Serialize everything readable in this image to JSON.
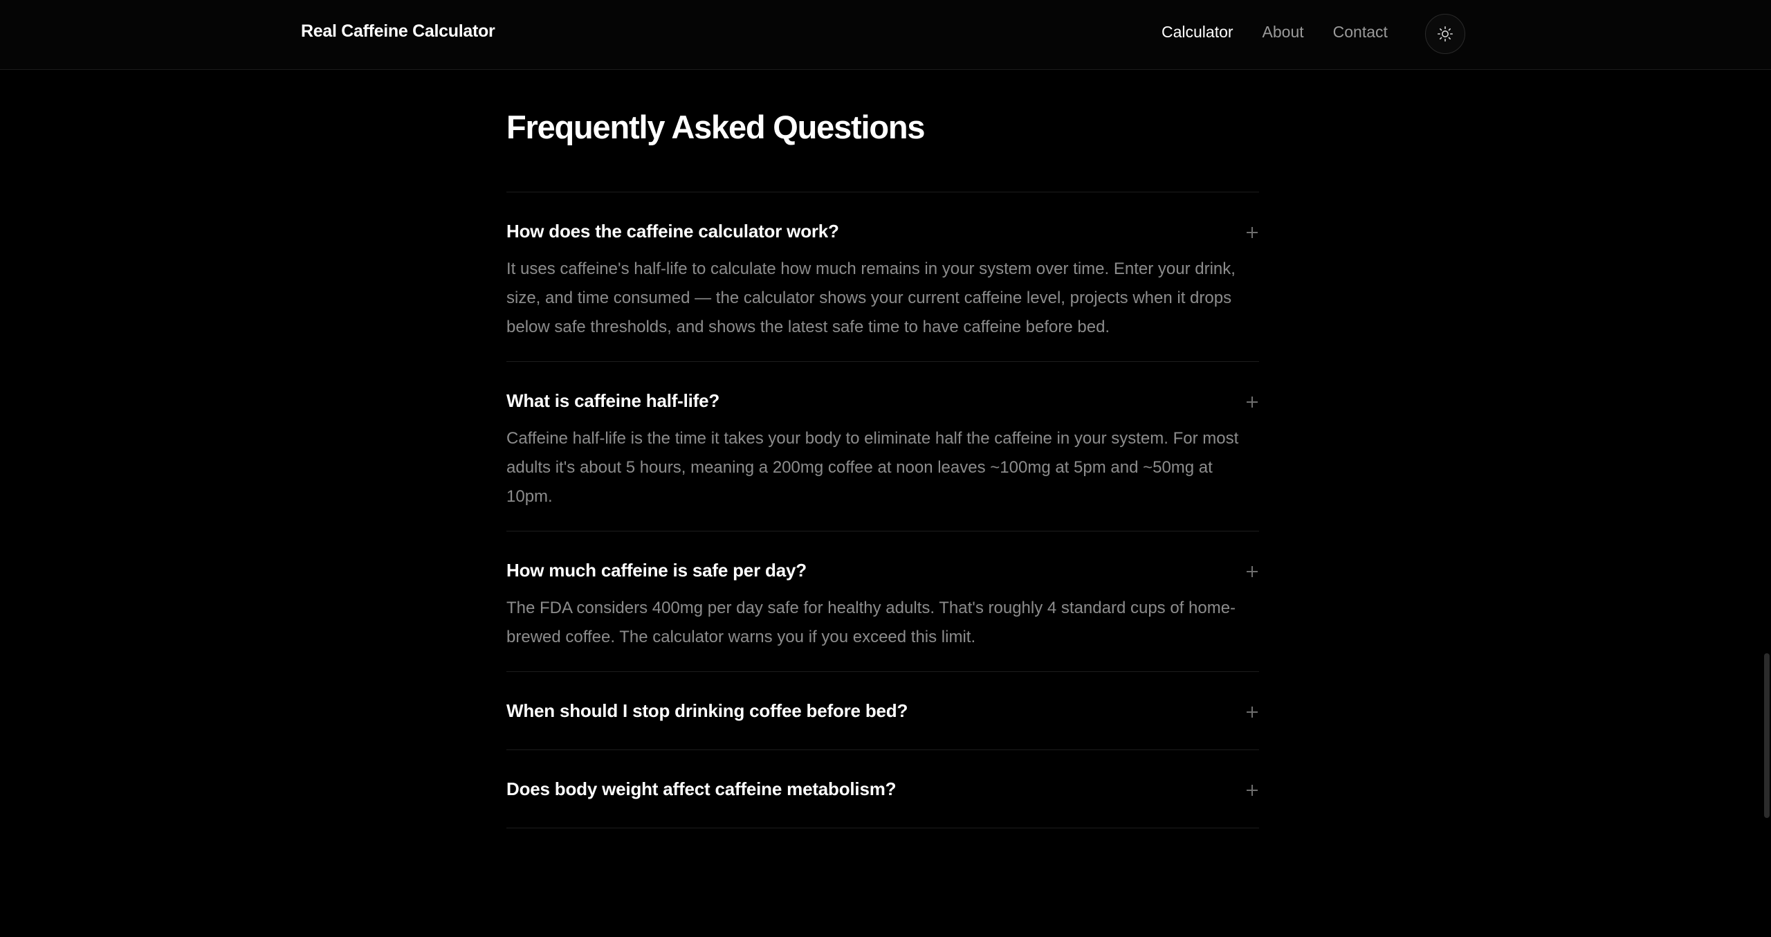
{
  "header": {
    "brand": "Real Caffeine Calculator",
    "nav": [
      {
        "label": "Calculator",
        "active": true
      },
      {
        "label": "About",
        "active": false
      },
      {
        "label": "Contact",
        "active": false
      }
    ],
    "theme_toggle_icon": "sun-icon"
  },
  "main": {
    "title": "Frequently Asked Questions",
    "faqs": [
      {
        "question": "How does the caffeine calculator work?",
        "answer": "It uses caffeine's half-life to calculate how much remains in your system over time. Enter your drink, size, and time consumed — the calculator shows your current caffeine level, projects when it drops below safe thresholds, and shows the latest safe time to have caffeine before bed.",
        "icon": "plus-icon"
      },
      {
        "question": "What is caffeine half-life?",
        "answer": "Caffeine half-life is the time it takes your body to eliminate half the caffeine in your system. For most adults it's about 5 hours, meaning a 200mg coffee at noon leaves ~100mg at 5pm and ~50mg at 10pm.",
        "icon": "plus-icon"
      },
      {
        "question": "How much caffeine is safe per day?",
        "answer": "The FDA considers 400mg per day safe for healthy adults. That's roughly 4 standard cups of home-brewed coffee. The calculator warns you if you exceed this limit.",
        "icon": "plus-icon"
      },
      {
        "question": "When should I stop drinking coffee before bed?",
        "answer": "",
        "icon": "plus-icon"
      },
      {
        "question": "Does body weight affect caffeine metabolism?",
        "answer": "",
        "icon": "plus-icon"
      }
    ]
  },
  "colors": {
    "background": "#000000",
    "text_primary": "#ffffff",
    "text_muted": "#8c8c8c",
    "divider": "#1d1d1d"
  }
}
